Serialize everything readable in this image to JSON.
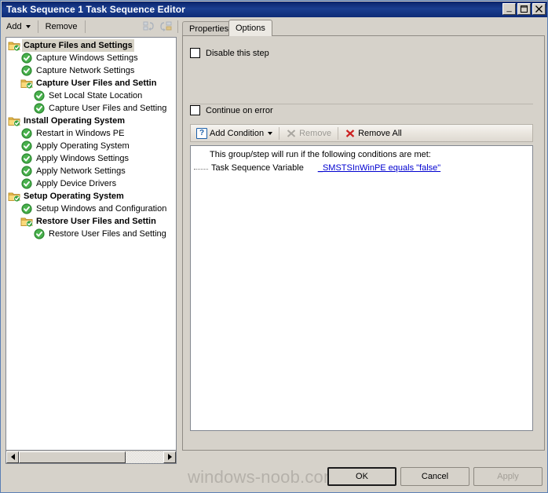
{
  "window": {
    "title": "Task Sequence 1 Task Sequence Editor",
    "minimize_label": "_",
    "maximize_label": "☐",
    "close_label": "✕"
  },
  "toolbar": {
    "add_label": "Add",
    "remove_label": "Remove",
    "icon_move_up": "move-step-icon",
    "icon_move_down": "reorder-step-icon"
  },
  "tree": {
    "nodes": [
      {
        "label": "Capture Files and Settings",
        "type": "group",
        "indent": 1,
        "selected": true
      },
      {
        "label": "Capture Windows Settings",
        "type": "step",
        "indent": 2,
        "selected": false
      },
      {
        "label": "Capture Network Settings",
        "type": "step",
        "indent": 2,
        "selected": false
      },
      {
        "label": "Capture User Files and Settin",
        "type": "group",
        "indent": 2,
        "selected": false
      },
      {
        "label": "Set Local State Location",
        "type": "step",
        "indent": 3,
        "selected": false
      },
      {
        "label": "Capture User Files and Setting",
        "type": "step",
        "indent": 3,
        "selected": false
      },
      {
        "label": "Install Operating System",
        "type": "group",
        "indent": 1,
        "selected": false
      },
      {
        "label": "Restart in Windows PE",
        "type": "step",
        "indent": 2,
        "selected": false
      },
      {
        "label": "Apply Operating System",
        "type": "step",
        "indent": 2,
        "selected": false
      },
      {
        "label": "Apply Windows Settings",
        "type": "step",
        "indent": 2,
        "selected": false
      },
      {
        "label": "Apply Network Settings",
        "type": "step",
        "indent": 2,
        "selected": false
      },
      {
        "label": "Apply Device Drivers",
        "type": "step",
        "indent": 2,
        "selected": false
      },
      {
        "label": "Setup Operating System",
        "type": "group",
        "indent": 1,
        "selected": false
      },
      {
        "label": "Setup Windows and Configuration",
        "type": "step",
        "indent": 2,
        "selected": false
      },
      {
        "label": "Restore User Files and Settin",
        "type": "group",
        "indent": 2,
        "selected": false
      },
      {
        "label": "Restore User Files and Setting",
        "type": "step",
        "indent": 3,
        "selected": false
      }
    ],
    "hscroll_thumb_percent": 74
  },
  "tabs": [
    {
      "label": "Properties",
      "active": false
    },
    {
      "label": "Options",
      "active": true
    }
  ],
  "options": {
    "disable_step_label": "Disable this step",
    "disable_step_checked": false,
    "continue_on_error_label": "Continue on error",
    "continue_on_error_checked": false
  },
  "condition_toolbar": {
    "add_condition_label": "Add Condition",
    "remove_label": "Remove",
    "remove_enabled": false,
    "remove_all_label": "Remove All",
    "remove_all_enabled": true,
    "add_condition_icon": "question-mark-icon",
    "remove_icon": "x-mark-icon",
    "remove_all_icon": "red-x-icon"
  },
  "condition_list": {
    "header": "This group/step will run if the following conditions are met:",
    "rows": [
      {
        "type": "Task Sequence Variable",
        "expression": "_SMSTSInWinPE equals \"false\"",
        "link_color": "#0000d0"
      }
    ]
  },
  "footer": {
    "watermark": "windows-noob.com",
    "ok_label": "OK",
    "cancel_label": "Cancel",
    "apply_label": "Apply",
    "apply_enabled": false
  },
  "colors": {
    "titlebar": "#0a246a",
    "window_bg": "#d6d2ca",
    "panel_bg": "#ffffff",
    "link": "#0000d0",
    "green_check": "#36a03a",
    "folder_yellow": "#f0c24b",
    "red_x": "#cc2222"
  }
}
